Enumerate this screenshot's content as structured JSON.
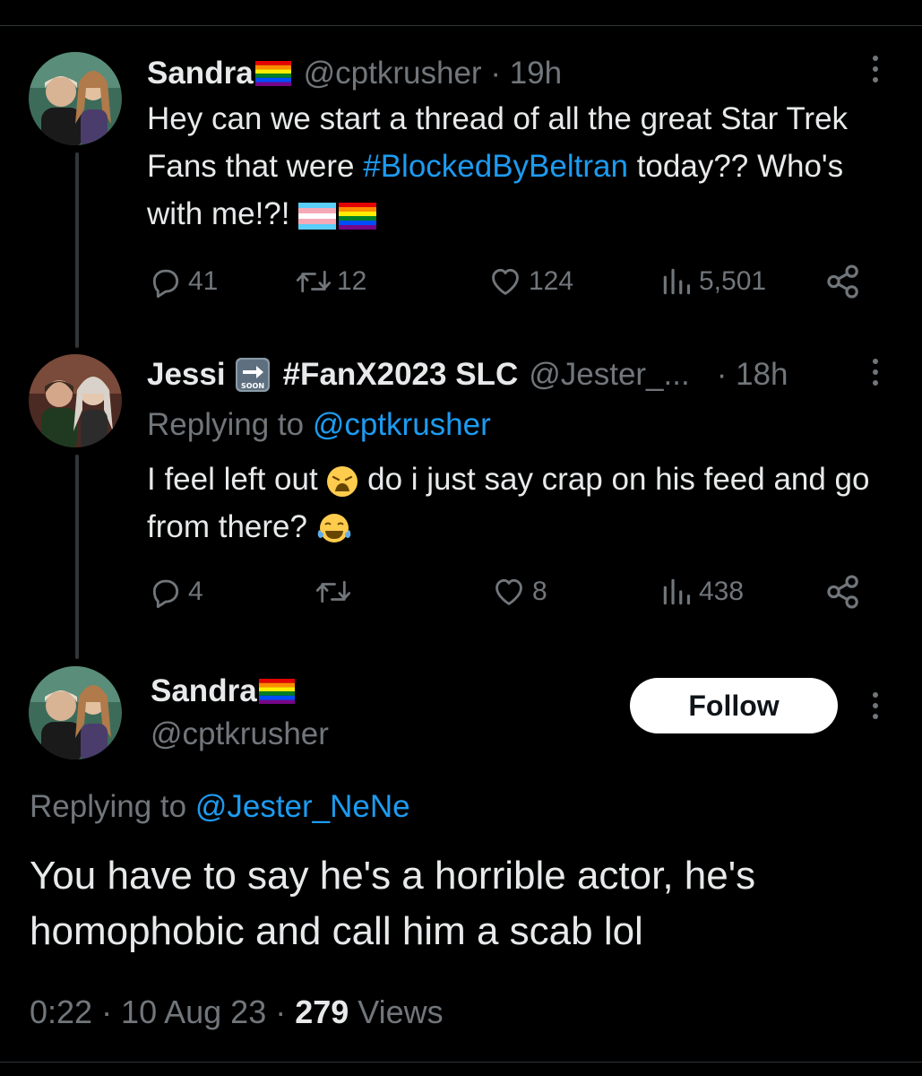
{
  "tweet1": {
    "name": "Sandra",
    "handle": "@cptkrusher",
    "sep": " · ",
    "time": "19h",
    "text_1": "Hey can we start a thread of all the great Star Trek Fans that were ",
    "hashtag": "#BlockedByBeltran",
    "text_2": " today?? Who's with me!?! ",
    "replies": "41",
    "retweets": "12",
    "likes": "124",
    "views": "5,501"
  },
  "tweet2": {
    "name": "Jessi",
    "name_tag": "#FanX2023 SLC",
    "handle": "@Jester_...",
    "time": "· 18h",
    "replying_prefix": "Replying to ",
    "replying_handle": "@cptkrusher",
    "text_1": "I feel left out ",
    "text_2": " do i just say crap on his feed and go from there? ",
    "replies": "4",
    "likes": "8",
    "views": "438"
  },
  "tweet3": {
    "name": "Sandra",
    "handle": "@cptkrusher",
    "follow_label": "Follow",
    "replying_prefix": "Replying to ",
    "replying_handle": "@Jester_NeNe",
    "text": "You have to say he's a horrible actor, he's homophobic and call him a scab lol",
    "time": "0:22 · 10 Aug 23 · ",
    "views_count": "279",
    "views_label": " Views"
  },
  "icons": {
    "reply": "reply-icon",
    "retweet": "retweet-icon",
    "like": "heart-icon",
    "views": "views-icon",
    "share": "share-icon",
    "more": "more-icon",
    "soon": "soon-arrow-emoji"
  },
  "colors": {
    "background": "#000000",
    "text": "#e7e9ea",
    "muted": "#71767b",
    "link": "#1d9bf0"
  }
}
